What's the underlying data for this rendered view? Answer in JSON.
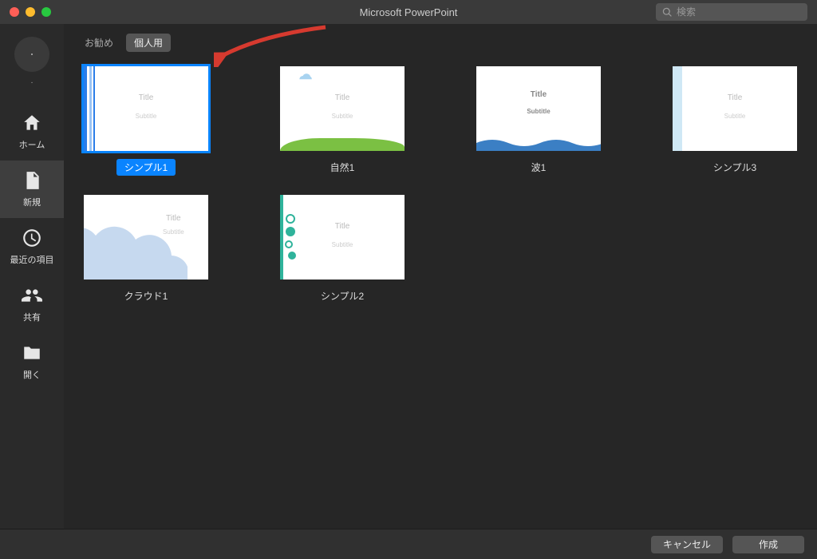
{
  "window": {
    "title": "Microsoft PowerPoint"
  },
  "search": {
    "placeholder": "検索"
  },
  "account": {
    "label": "."
  },
  "sidebar": {
    "items": [
      {
        "id": "home",
        "label": "ホーム"
      },
      {
        "id": "new",
        "label": "新規"
      },
      {
        "id": "recent",
        "label": "最近の項目"
      },
      {
        "id": "shared",
        "label": "共有"
      },
      {
        "id": "open",
        "label": "開く"
      }
    ],
    "active": "new"
  },
  "tabs": {
    "items": [
      {
        "id": "recommended",
        "label": "お勧め"
      },
      {
        "id": "personal",
        "label": "個人用"
      }
    ],
    "active": "personal"
  },
  "thumb_text": {
    "title": "Title",
    "subtitle": "Subtitle"
  },
  "templates": [
    {
      "id": "simple1",
      "label": "シンプル1",
      "selected": true
    },
    {
      "id": "nature1",
      "label": "自然1"
    },
    {
      "id": "wave1",
      "label": "波1"
    },
    {
      "id": "simple3",
      "label": "シンプル3"
    },
    {
      "id": "cloud1",
      "label": "クラウド1"
    },
    {
      "id": "simple2",
      "label": "シンプル2"
    }
  ],
  "footer": {
    "cancel": "キャンセル",
    "create": "作成"
  },
  "annotation": {
    "arrow_points_to": "tab-personal"
  },
  "colors": {
    "accent": "#0a84ff",
    "bg": "#262626",
    "sidebar_bg": "#2a2a2a"
  }
}
